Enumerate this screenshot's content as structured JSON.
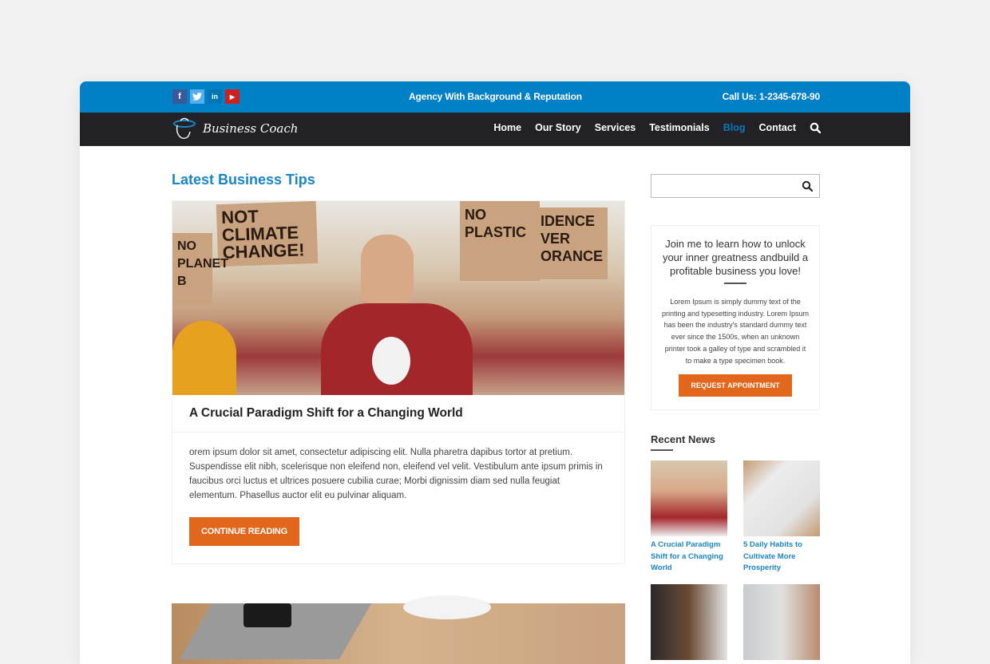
{
  "topbar": {
    "social": [
      {
        "icon": "facebook-icon",
        "glyph": "f"
      },
      {
        "icon": "twitter-icon",
        "glyph": "t"
      },
      {
        "icon": "linkedin-icon",
        "glyph": "in"
      },
      {
        "icon": "youtube-icon",
        "glyph": "▶"
      }
    ],
    "tagline": "Agency With Background & Reputation",
    "call": "Call Us: 1-2345-678-90"
  },
  "navbar": {
    "logo_text": "Business Coach",
    "items": [
      {
        "label": "Home",
        "active": false
      },
      {
        "label": "Our Story",
        "active": false
      },
      {
        "label": "Services",
        "active": false
      },
      {
        "label": "Testimonials",
        "active": false
      },
      {
        "label": "Blog",
        "active": true
      },
      {
        "label": "Contact",
        "active": false
      }
    ]
  },
  "main": {
    "section_title": "Latest Business Tips",
    "posts": [
      {
        "image_signs": [
          "NOT CLIMATE CHANGE!",
          "NO PLASTIC",
          "IDENCE VER ORANCE",
          "NO PLANET B"
        ],
        "title": "A Crucial Paradigm Shift for a Changing World",
        "excerpt": "orem ipsum dolor sit amet, consectetur adipiscing elit. Nulla pharetra dapibus tortor at pretium. Suspendisse elit nibh, scelerisque non eleifend non, eleifend vel velit. Vestibulum ante ipsum primis in faucibus orci luctus et ultrices posuere cubilia curae; Morbi dignissim diam sed nulla feugiat elementum. Phasellus auctor elit eu pulvinar aliquam.",
        "button": "CONTINUE READING"
      }
    ]
  },
  "sidebar": {
    "search": {
      "placeholder": "",
      "value": ""
    },
    "cta": {
      "heading": "Join me to learn how to unlock your inner greatness andbuild a profitable business you love!",
      "text": "Lorem Ipsum is simply dummy text of the printing and typesetting industry. Lorem Ipsum has been the industry's standard dummy text ever since the 1500s, when an unknown printer took a galley of type and scrambled it to make a type specimen book.",
      "button": "REQUEST APPOINTMENT"
    },
    "recent_news": {
      "title": "Recent News",
      "items": [
        {
          "label": "A Crucial Paradigm Shift for a Changing World"
        },
        {
          "label": "5 Daily Habits to Cultivate More Prosperity"
        },
        {
          "label": ""
        },
        {
          "label": ""
        }
      ]
    }
  },
  "colors": {
    "topbar": "#0080c6",
    "navbar": "#222226",
    "accent": "#1a86c4",
    "button": "#e2671c"
  }
}
